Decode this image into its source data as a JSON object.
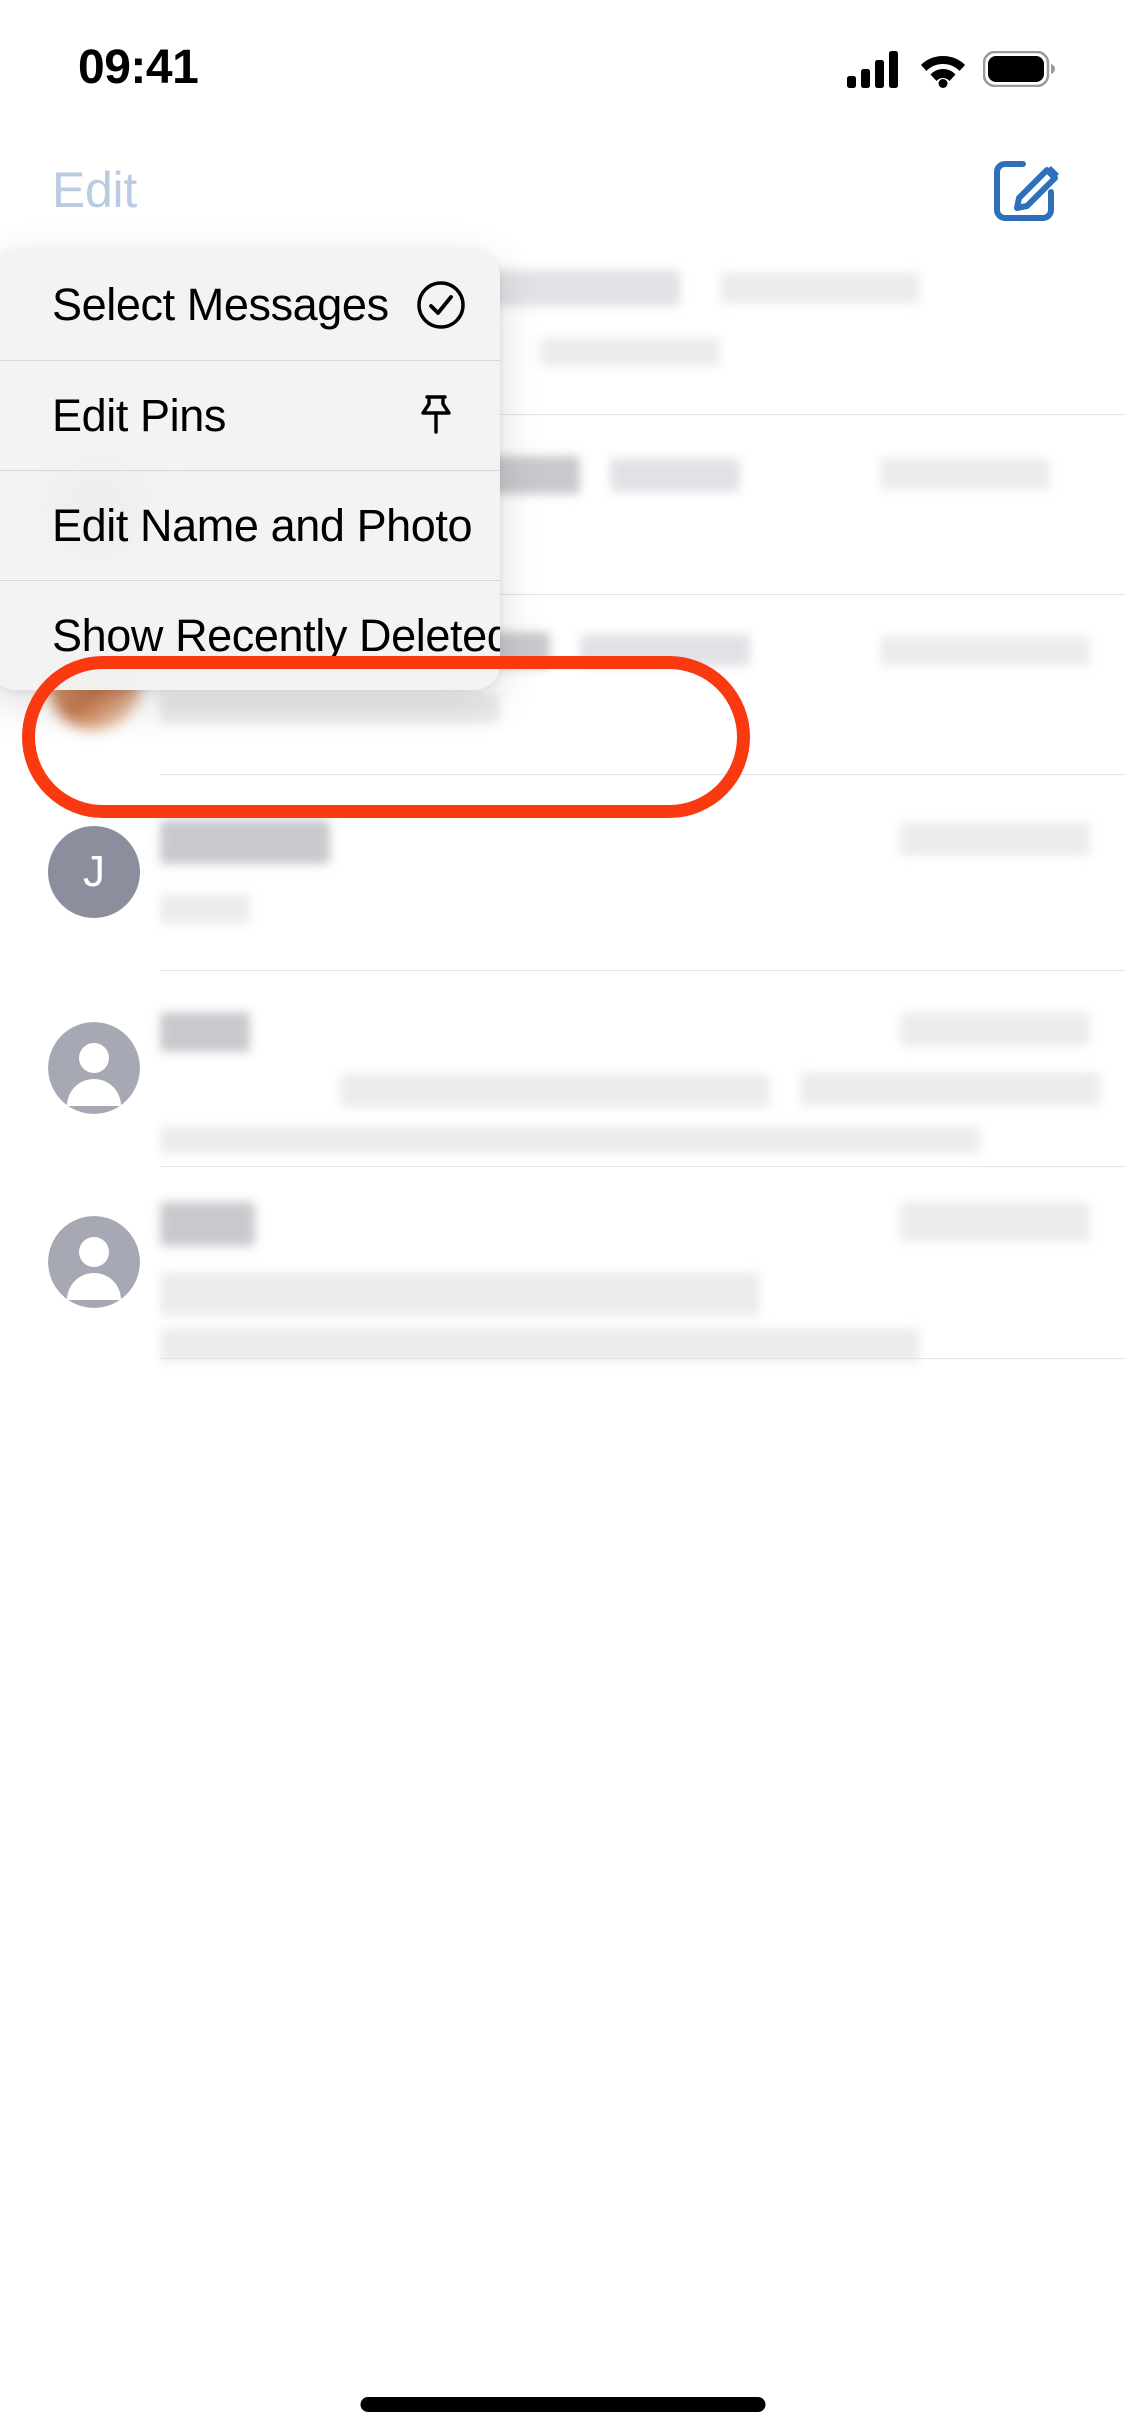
{
  "status_bar": {
    "time": "09:41",
    "cellular_icon": "cellular-signal-icon",
    "wifi_icon": "wifi-icon",
    "battery_icon": "battery-full-icon"
  },
  "nav_bar": {
    "edit_label": "Edit",
    "edit_color": "#b9cbe0",
    "compose_icon": "compose-new-message-icon",
    "compose_color": "#2f6fba"
  },
  "context_menu": {
    "items": [
      {
        "label": "Select Messages",
        "icon": "checkmark-circle-icon"
      },
      {
        "label": "Edit Pins",
        "icon": "pushpin-icon"
      },
      {
        "label": "Edit Name and Photo",
        "icon": "person-circle-icon"
      },
      {
        "label": "Show Recently Deleted",
        "icon": "trash-icon",
        "highlighted": true
      }
    ],
    "highlight_color": "#f93a10"
  },
  "conversation_list": {
    "rows": [
      {
        "avatar_type": "blurred-photo",
        "avatar_label": "",
        "redacted": true
      },
      {
        "avatar_type": "blurred-photo",
        "avatar_label": "",
        "redacted": true
      },
      {
        "avatar_type": "monogram",
        "avatar_label": "J",
        "redacted": true
      },
      {
        "avatar_type": "person-placeholder",
        "avatar_label": "",
        "redacted": true
      },
      {
        "avatar_type": "person-placeholder",
        "avatar_label": "",
        "redacted": true
      }
    ]
  },
  "home_indicator": {
    "name": "home-indicator"
  }
}
